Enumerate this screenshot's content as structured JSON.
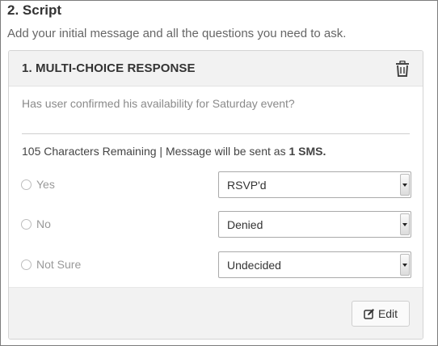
{
  "section": {
    "title": "2. Script",
    "description": "Add your initial message and all the questions you need to ask."
  },
  "card": {
    "title": "1.  MULTI-CHOICE RESPONSE",
    "delete_icon": "trash-icon",
    "question": "Has user confirmed his availability for Saturday event?",
    "chars_remaining": "105 Characters Remaining | Message will be sent as ",
    "sms_count": "1 SMS.",
    "options": [
      {
        "label": "Yes",
        "response": "RSVP'd"
      },
      {
        "label": "No",
        "response": "Denied"
      },
      {
        "label": "Not Sure",
        "response": "Undecided"
      }
    ],
    "edit_label": "Edit",
    "edit_icon": "edit-icon"
  }
}
